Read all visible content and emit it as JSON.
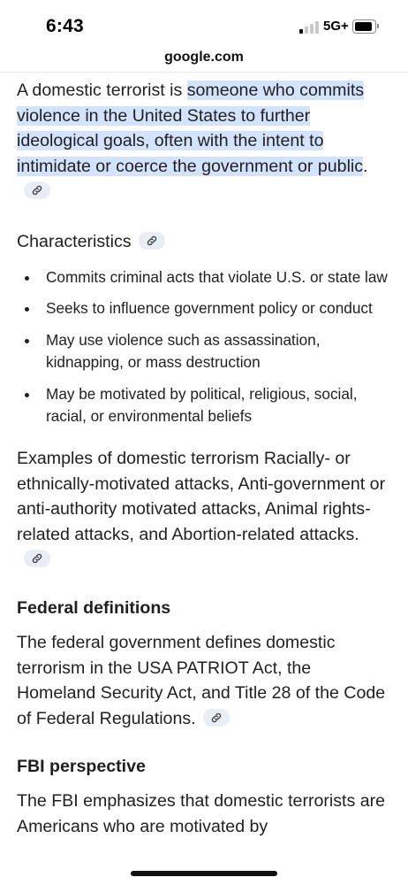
{
  "status_bar": {
    "time": "6:43",
    "network": "5G+"
  },
  "browser": {
    "url": "google.com"
  },
  "intro": {
    "prefix": "A domestic terrorist is ",
    "highlight": "someone who commits violence in the United States to further ideological goals, often with the intent to intimidate or coerce the government or public",
    "suffix": "."
  },
  "characteristics": {
    "title": "Characteristics",
    "items": [
      "Commits criminal acts that violate U.S. or state law",
      "Seeks to influence government policy or conduct",
      "May use violence such as assassination, kidnapping, or mass destruction",
      "May be motivated by political, religious, social, racial, or environmental beliefs"
    ]
  },
  "examples": {
    "text": "Examples of domestic terrorism Racially- or ethnically-motivated attacks, Anti-government or anti-authority motivated attacks, Animal rights-related attacks, and Abortion-related attacks."
  },
  "federal": {
    "title": "Federal definitions",
    "text": "The federal government defines domestic terrorism in the USA PATRIOT Act, the Homeland Security Act, and Title 28 of the Code of Federal Regulations."
  },
  "fbi": {
    "title": "FBI perspective",
    "text": "The FBI emphasizes that domestic terrorists are Americans who are motivated by"
  },
  "icons": {
    "source_link": "link-icon"
  },
  "colors": {
    "highlight": "#d3e3fd",
    "chip": "#e9eef6",
    "text": "#1f1f1f"
  }
}
